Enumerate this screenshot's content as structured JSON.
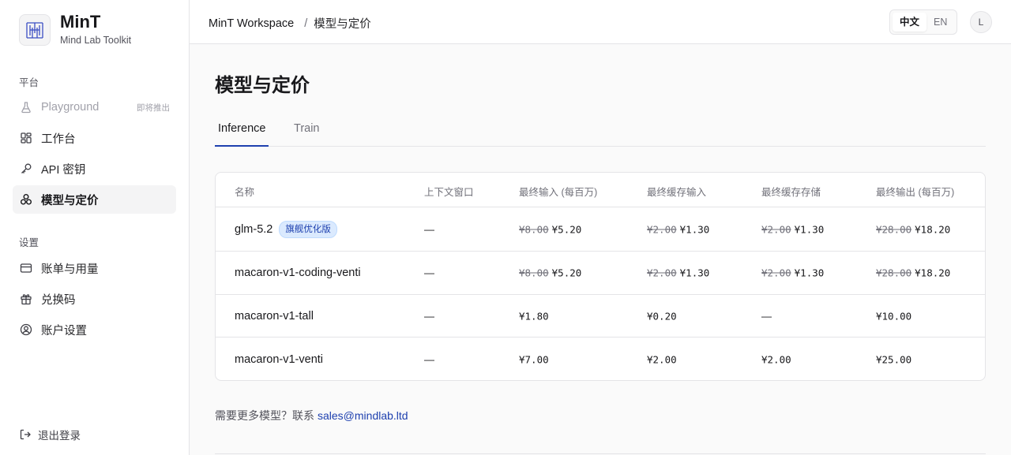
{
  "brand": {
    "name": "MinT",
    "subtitle": "Mind Lab Toolkit"
  },
  "sidebar": {
    "sections": [
      {
        "label": "平台",
        "items": [
          {
            "label": "Playground",
            "icon": "flask-icon",
            "badge": "即将推出",
            "disabled": true
          },
          {
            "label": "工作台",
            "icon": "dashboard-icon"
          },
          {
            "label": "API 密钥",
            "icon": "key-icon"
          },
          {
            "label": "模型与定价",
            "icon": "models-icon",
            "active": true
          }
        ]
      },
      {
        "label": "设置",
        "items": [
          {
            "label": "账单与用量",
            "icon": "credit-card-icon"
          },
          {
            "label": "兑换码",
            "icon": "gift-icon"
          },
          {
            "label": "账户设置",
            "icon": "user-circle-icon"
          }
        ]
      }
    ],
    "logout": "退出登录"
  },
  "topbar": {
    "breadcrumb": [
      "MinT Workspace",
      "/",
      "模型与定价"
    ],
    "lang": [
      "中文",
      "EN"
    ],
    "lang_selected": "中文",
    "avatar": "L"
  },
  "page": {
    "title": "模型与定价",
    "tabs": [
      "Inference",
      "Train"
    ],
    "active_tab": "Inference"
  },
  "table": {
    "columns": [
      "名称",
      "上下文窗口",
      "最终输入 (每百万)",
      "最终缓存输入",
      "最终缓存存储",
      "最终输出 (每百万)"
    ],
    "rows": [
      {
        "name": "glm-5.2",
        "badge": "旗舰优化版",
        "context": "—",
        "input": {
          "old": "¥8.00",
          "new": "¥5.20"
        },
        "cache_input": {
          "old": "¥2.00",
          "new": "¥1.30"
        },
        "cache_storage": {
          "old": "¥2.00",
          "new": "¥1.30"
        },
        "output": {
          "old": "¥28.00",
          "new": "¥18.20"
        }
      },
      {
        "name": "macaron-v1-coding-venti",
        "context": "—",
        "input": {
          "old": "¥8.00",
          "new": "¥5.20"
        },
        "cache_input": {
          "old": "¥2.00",
          "new": "¥1.30"
        },
        "cache_storage": {
          "old": "¥2.00",
          "new": "¥1.30"
        },
        "output": {
          "old": "¥28.00",
          "new": "¥18.20"
        }
      },
      {
        "name": "macaron-v1-tall",
        "context": "—",
        "input": {
          "new": "¥1.80"
        },
        "cache_input": {
          "new": "¥0.20"
        },
        "cache_storage": {
          "new": "—"
        },
        "output": {
          "new": "¥10.00"
        }
      },
      {
        "name": "macaron-v1-venti",
        "context": "—",
        "input": {
          "new": "¥7.00"
        },
        "cache_input": {
          "new": "¥2.00"
        },
        "cache_storage": {
          "new": "¥2.00"
        },
        "output": {
          "new": "¥25.00"
        }
      }
    ]
  },
  "footer": {
    "text": "需要更多模型？联系",
    "email": "sales@mindlab.ltd"
  },
  "colors": {
    "accent": "#1e40af",
    "badge_bg": "#dbeafe",
    "border": "#e4e4e7"
  }
}
